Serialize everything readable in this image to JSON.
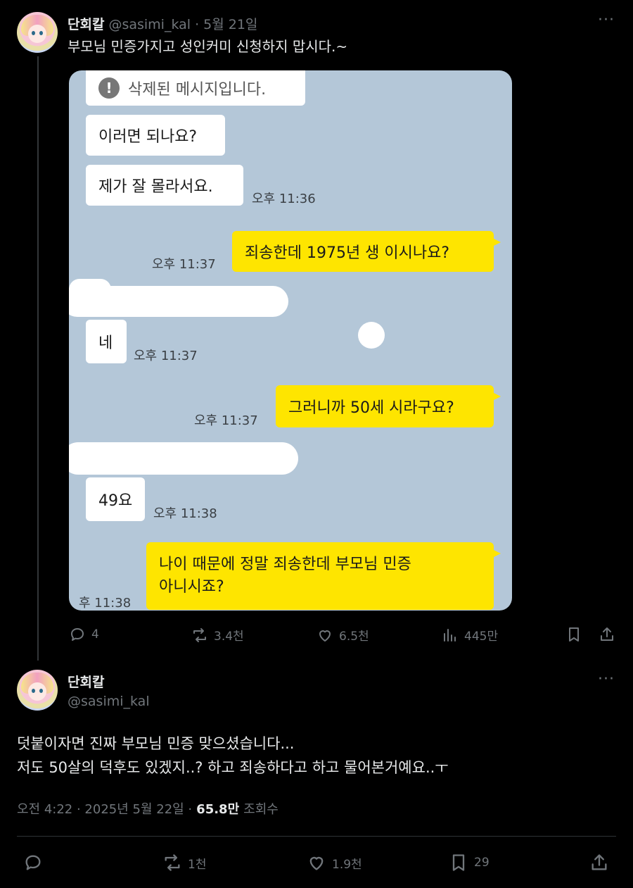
{
  "tweet1": {
    "name": "단회칼",
    "handle": "@sasimi_kal",
    "date": "· 5월 21일",
    "text": "부모님 민증가지고 성인커미 신청하지 맙시다.~",
    "chat": {
      "deleted_message": "삭제된 메시지입니다.",
      "messages": [
        {
          "side": "left",
          "text": "이러면 되나요?"
        },
        {
          "side": "left",
          "text": "제가 잘 몰라서요.",
          "time": "오후 11:36"
        },
        {
          "side": "right",
          "text": "죄송한데 1975년 생 이시나요?",
          "time": "오후 11:37"
        },
        {
          "side": "left",
          "text": "네",
          "time": "오후 11:37"
        },
        {
          "side": "right",
          "text": "그러니까 50세 시라구요?",
          "time": "오후 11:37"
        },
        {
          "side": "left",
          "text": "49요",
          "time": "오후 11:38"
        },
        {
          "side": "right",
          "text_line1": "나이 때문에 정말 죄송한데 부모님 민증",
          "text_line2": "아니시죠?",
          "time": "후 11:38"
        }
      ]
    },
    "stats": {
      "replies": "4",
      "retweets": "3.4천",
      "likes": "6.5천",
      "views": "445만"
    }
  },
  "tweet2": {
    "name": "단회칼",
    "handle": "@sasimi_kal",
    "text_line1": "덧붙이자면 진짜 부모님 민증 맞으셨습니다...",
    "text_line2": "저도 50살의 덕후도 있겠지..? 하고 죄송하다고 하고 물어본거예요..ㅜ",
    "timestamp": "오전 4:22 · 2025년 5월 22일 ·",
    "views_count": "65.8만",
    "views_label": "조회수",
    "stats": {
      "replies": "",
      "retweets": "1천",
      "likes": "1.9천",
      "bookmarks": "29"
    }
  },
  "icons": {
    "more": "more-icon",
    "reply": "reply-icon",
    "retweet": "retweet-icon",
    "like": "heart-icon",
    "views": "views-icon",
    "bookmark": "bookmark-icon",
    "share": "share-icon"
  },
  "colors": {
    "background": "#000000",
    "text": "#e7e9ea",
    "muted": "#71767b",
    "chat_bg": "#b4c7d8",
    "yellow_bubble": "#fee500"
  }
}
